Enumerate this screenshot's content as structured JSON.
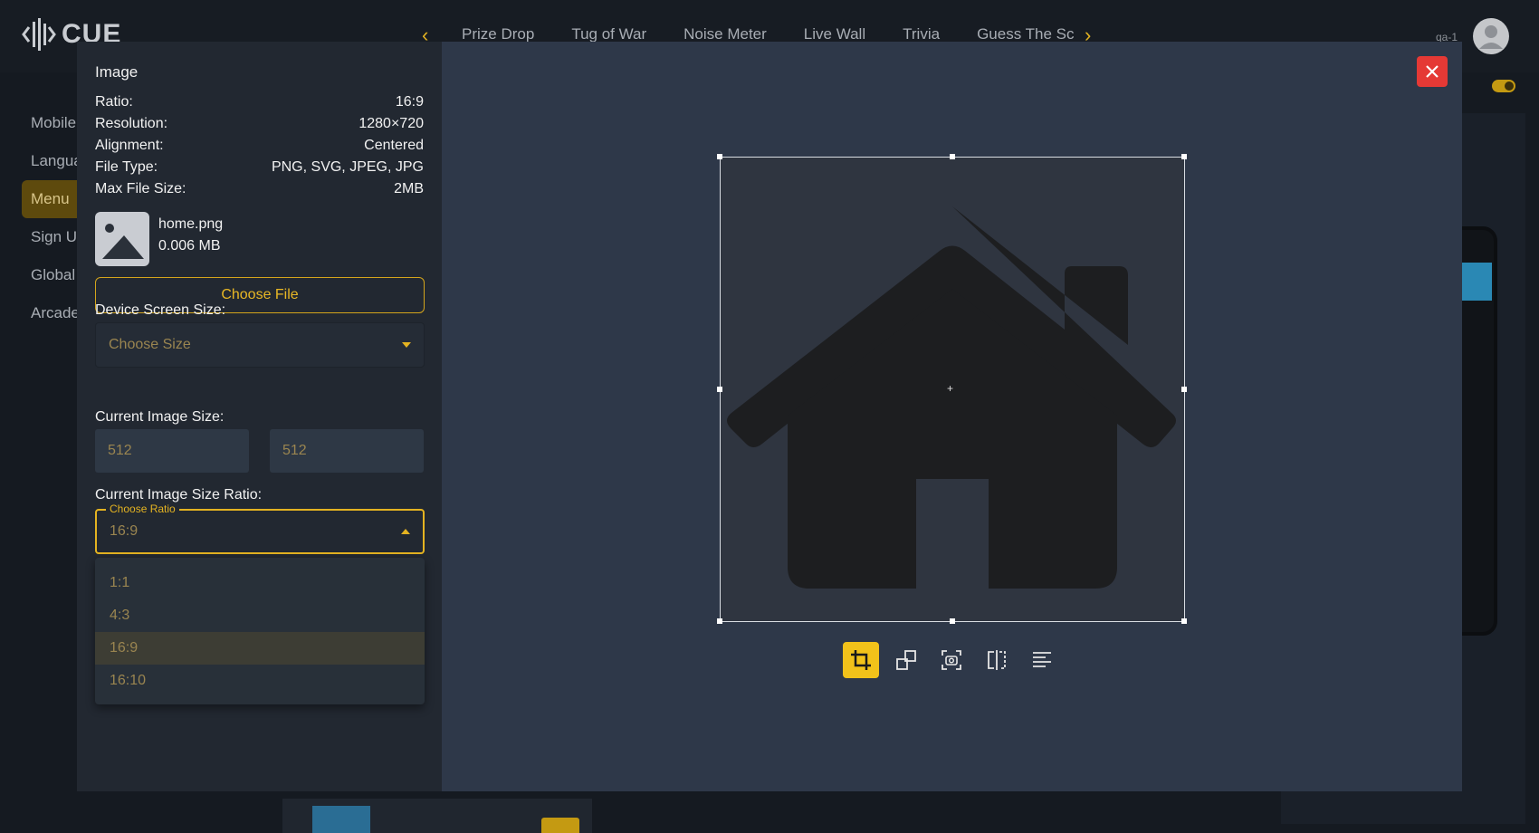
{
  "app": {
    "logo_text": "CUE",
    "nav_tabs": [
      "Prize Drop",
      "Tug of War",
      "Noise Meter",
      "Live Wall",
      "Trivia",
      "Guess The Sc"
    ],
    "user_label": "qa-1",
    "side_menu": [
      "Mobile",
      "Langua",
      "Menu",
      "Sign U",
      "Global",
      "Arcade"
    ],
    "accent_color": "#e4b321"
  },
  "modal": {
    "title": "Image",
    "info": [
      {
        "label": "Ratio:",
        "value": "16:9"
      },
      {
        "label": "Resolution:",
        "value": "1280×720"
      },
      {
        "label": "Alignment:",
        "value": "Centered"
      },
      {
        "label": "File Type:",
        "value": "PNG, SVG, JPEG, JPG"
      },
      {
        "label": "Max File Size:",
        "value": "2MB"
      }
    ],
    "file": {
      "name": "home.png",
      "size": "0.006 MB"
    },
    "choose_file_label": "Choose File",
    "device_label": "Device Screen Size:",
    "device_placeholder": "Choose Size",
    "image_size_label": "Current Image Size:",
    "width_value": "512",
    "height_value": "512",
    "ratio_label": "Current Image Size Ratio:",
    "ratio_legend": "Choose Ratio",
    "ratio_value": "16:9",
    "ratio_options": [
      "1:1",
      "4:3",
      "16:9",
      "16:10"
    ],
    "close_color": "#e53935",
    "tools": [
      "crop-icon",
      "rotate-icon",
      "screenshot-icon",
      "flip-icon",
      "align-icon"
    ]
  }
}
